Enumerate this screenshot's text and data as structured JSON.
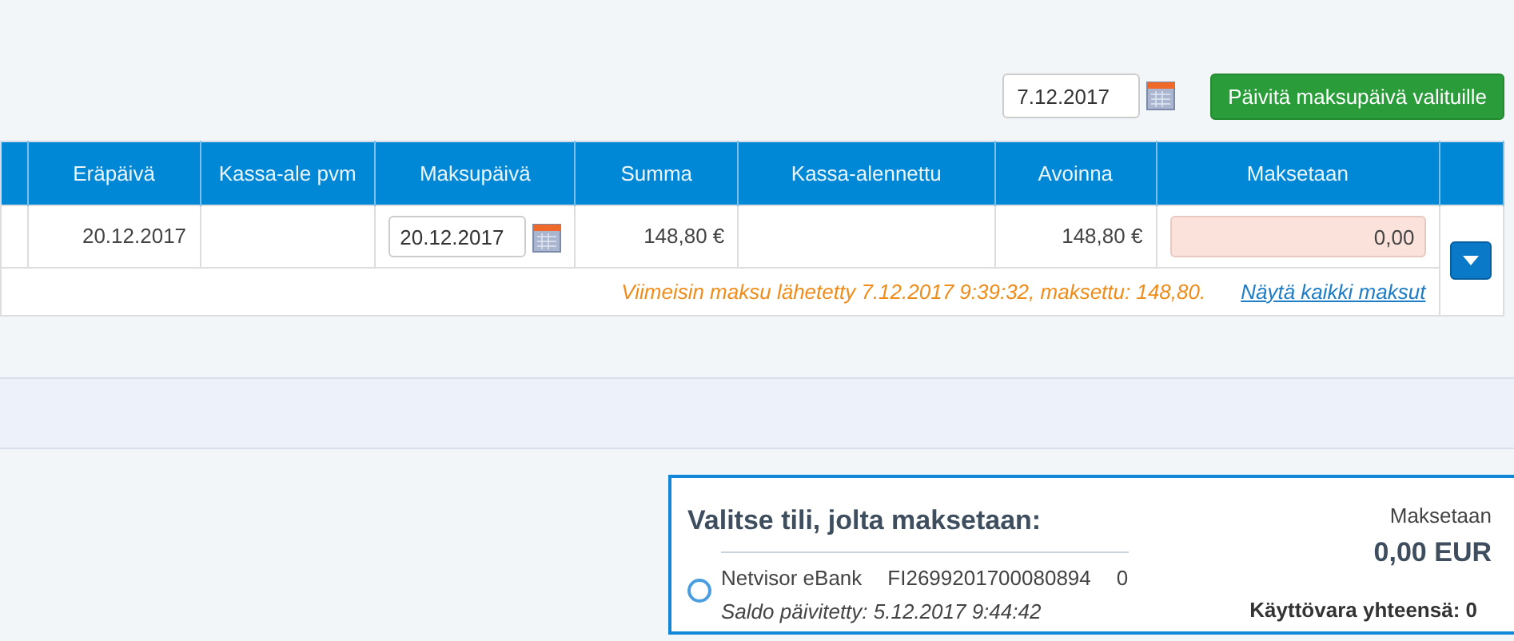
{
  "toolbar": {
    "date_value": "7.12.2017",
    "button": "Päivitä maksupäivä valituille"
  },
  "table": {
    "columns": [
      "",
      "Eräpäivä",
      "Kassa-ale pvm",
      "Maksupäivä",
      "Summa",
      "Kassa-alennettu",
      "Avoinna",
      "Maksetaan",
      ""
    ],
    "rows": [
      {
        "due_date": "20.12.2017",
        "cash_discount_date": "",
        "payment_date": "20.12.2017",
        "sum": "148,80 €",
        "discounted": "",
        "open": "148,80 €",
        "paying": "0,00",
        "note": "Viimeisin maksu lähetetty 7.12.2017 9:39:32, maksettu: 148,80.",
        "link": "Näytä kaikki maksut"
      }
    ]
  },
  "account_panel": {
    "title": "Valitse tili, jolta maksetaan:",
    "paying_label": "Maksetaan",
    "paying_amount": "0,00 EUR",
    "total_label": "Käyttövara yhteensä: 0",
    "accounts": [
      {
        "name": "Netvisor eBank",
        "iban": "FI2699201700080894",
        "balance": "0",
        "updated": "Saldo päivitetty: 5.12.2017 9:44:42",
        "selected": false
      }
    ]
  }
}
